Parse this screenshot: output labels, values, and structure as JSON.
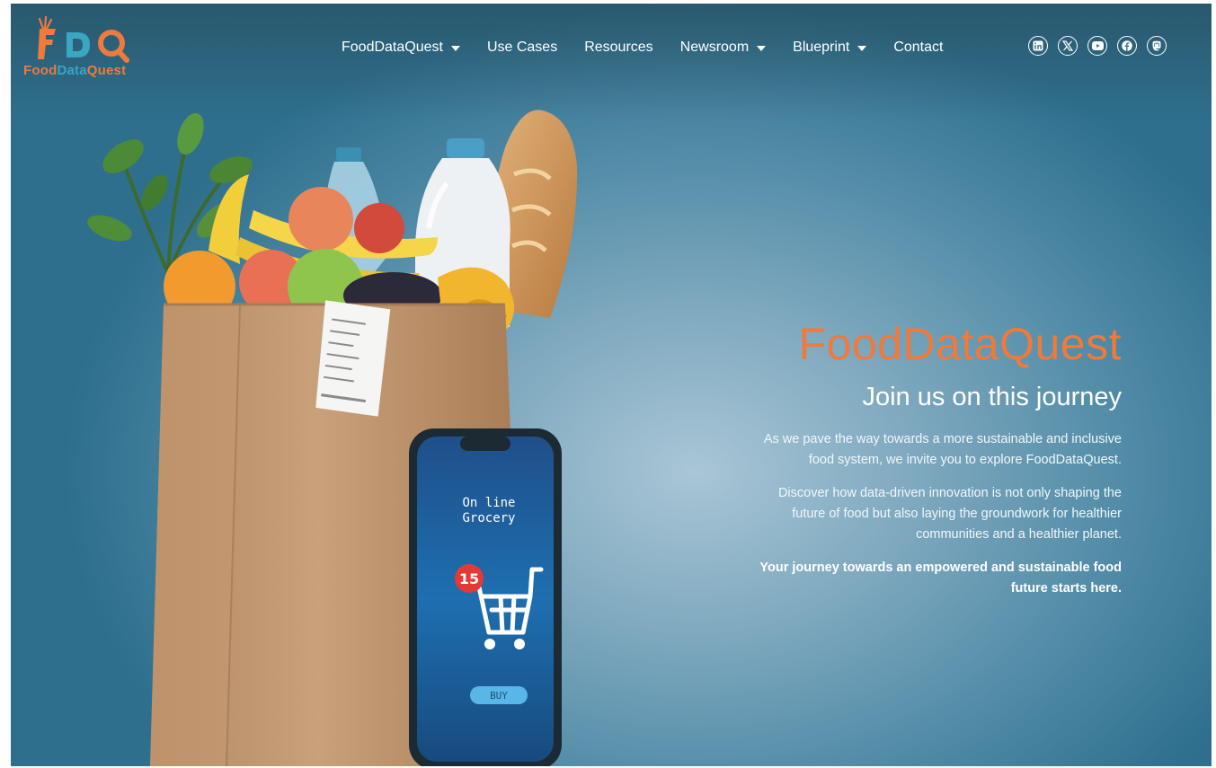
{
  "logo": {
    "mark": "FDQ",
    "text_food": "Food",
    "text_data": "Data",
    "text_quest": "Quest"
  },
  "nav": [
    {
      "label": "FoodDataQuest",
      "dropdown": true
    },
    {
      "label": "Use Cases",
      "dropdown": false
    },
    {
      "label": "Resources",
      "dropdown": false
    },
    {
      "label": "Newsroom",
      "dropdown": true
    },
    {
      "label": "Blueprint",
      "dropdown": true
    },
    {
      "label": "Contact",
      "dropdown": false
    }
  ],
  "socials": [
    "linkedin-icon",
    "x-icon",
    "youtube-icon",
    "facebook-icon",
    "mastodon-icon"
  ],
  "hero": {
    "phone_title_line1": "On line",
    "phone_title_line2": "Grocery",
    "cart_badge": "15",
    "buy_label": "BUY"
  },
  "copy": {
    "title": "FoodDataQuest",
    "subtitle": "Join us on this journey",
    "para1": "As we pave the way towards a more sustainable and inclusive food system, we invite you to explore FoodDataQuest.",
    "para2": "Discover how data-driven innovation is not only shaping the future of food but also laying the groundwork for healthier communities and a healthier planet.",
    "para3": "Your journey towards an empowered and sustainable food future starts here."
  },
  "colors": {
    "accent": "#ee7a3c",
    "teal": "#3aa6c2",
    "background": "#4f8aa6"
  }
}
